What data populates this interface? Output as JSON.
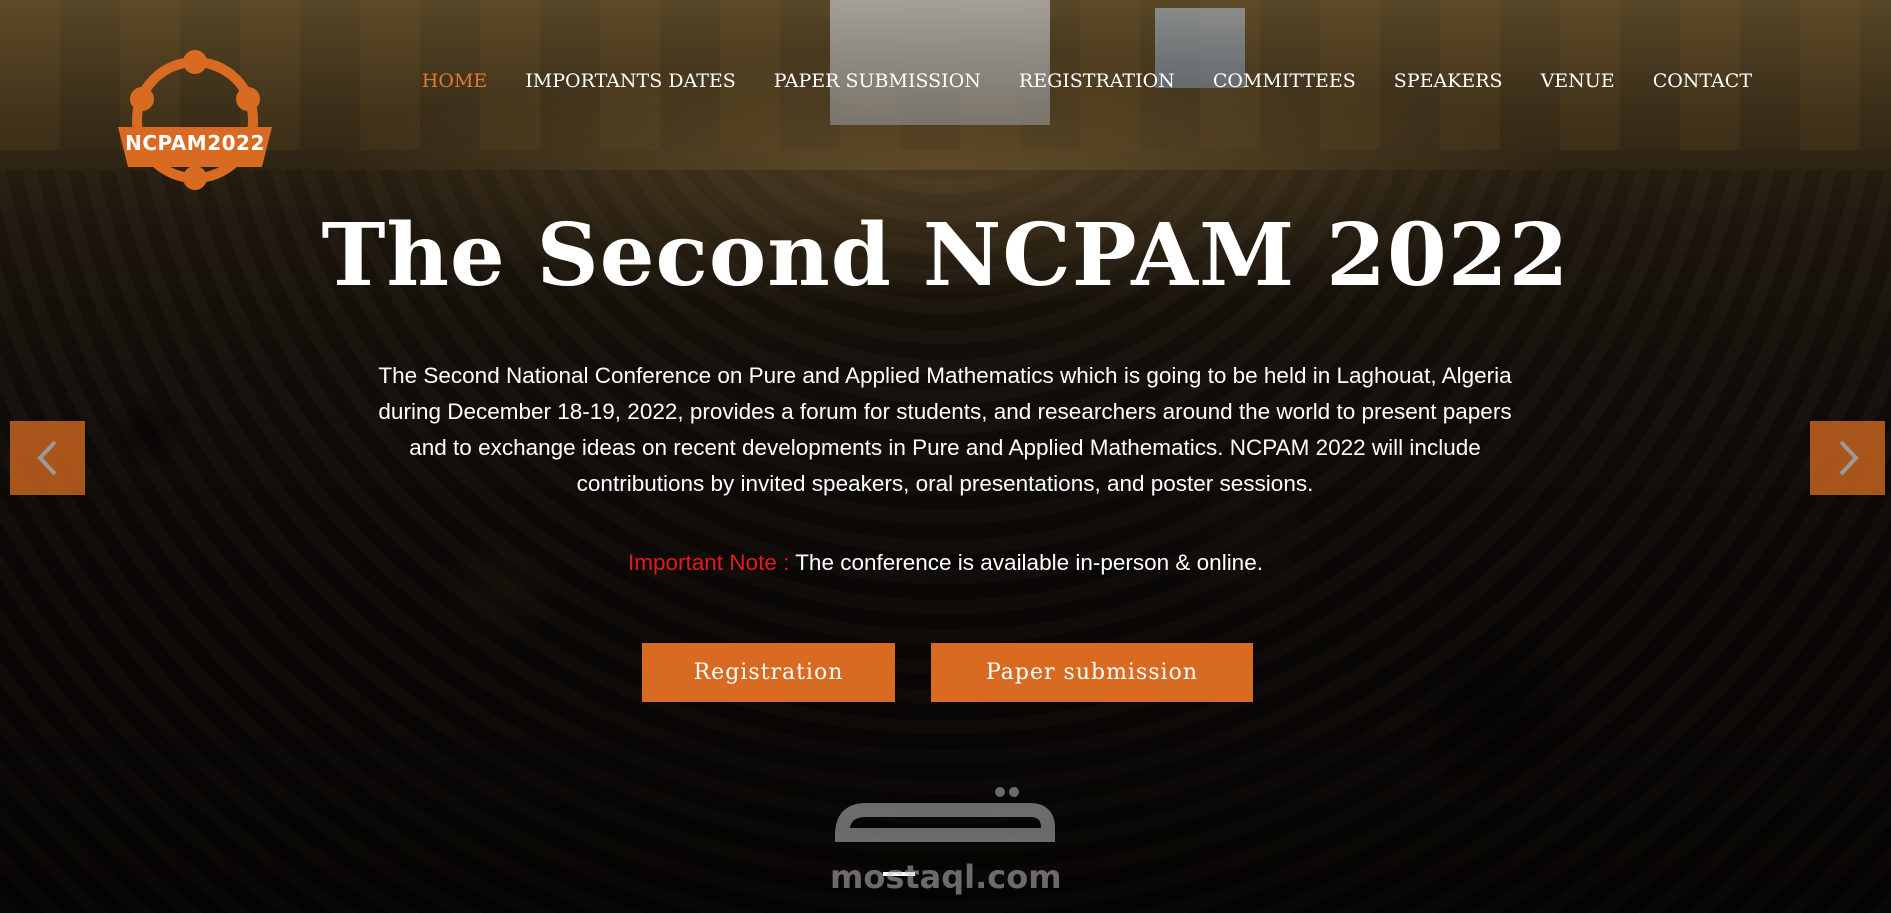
{
  "logo": {
    "text": "NCPAM2022",
    "color": "#d96a22"
  },
  "nav": {
    "items": [
      {
        "label": "HOME",
        "active": true
      },
      {
        "label": "IMPORTANTS DATES",
        "active": false
      },
      {
        "label": "PAPER SUBMISSION",
        "active": false
      },
      {
        "label": "REGISTRATION",
        "active": false
      },
      {
        "label": "COMMITTEES",
        "active": false
      },
      {
        "label": "SPEAKERS",
        "active": false
      },
      {
        "label": "VENUE",
        "active": false
      },
      {
        "label": "CONTACT",
        "active": false
      }
    ],
    "active_color": "#e07a2e"
  },
  "hero": {
    "title": "The Second NCPAM 2022",
    "description": "The Second National Conference on Pure and Applied Mathematics which is going to be held in Laghouat, Algeria during December 18-19, 2022, provides a forum for students, and researchers around the world to present papers and to exchange ideas on recent developments in Pure and Applied Mathematics. NCPAM 2022 will include contributions by invited speakers, oral presentations, and poster sessions.",
    "note_label": "Important Note :",
    "note_text": " The conference is available in-person & online.",
    "note_label_color": "#e4191e"
  },
  "buttons": {
    "registration": "Registration",
    "paper_submission": "Paper submission",
    "color": "#d96a22"
  },
  "carousel": {
    "prev_icon": "chevron-left-icon",
    "next_icon": "chevron-right-icon"
  },
  "watermark": {
    "arabic": "مستقل",
    "latin": "mostaql.com"
  }
}
